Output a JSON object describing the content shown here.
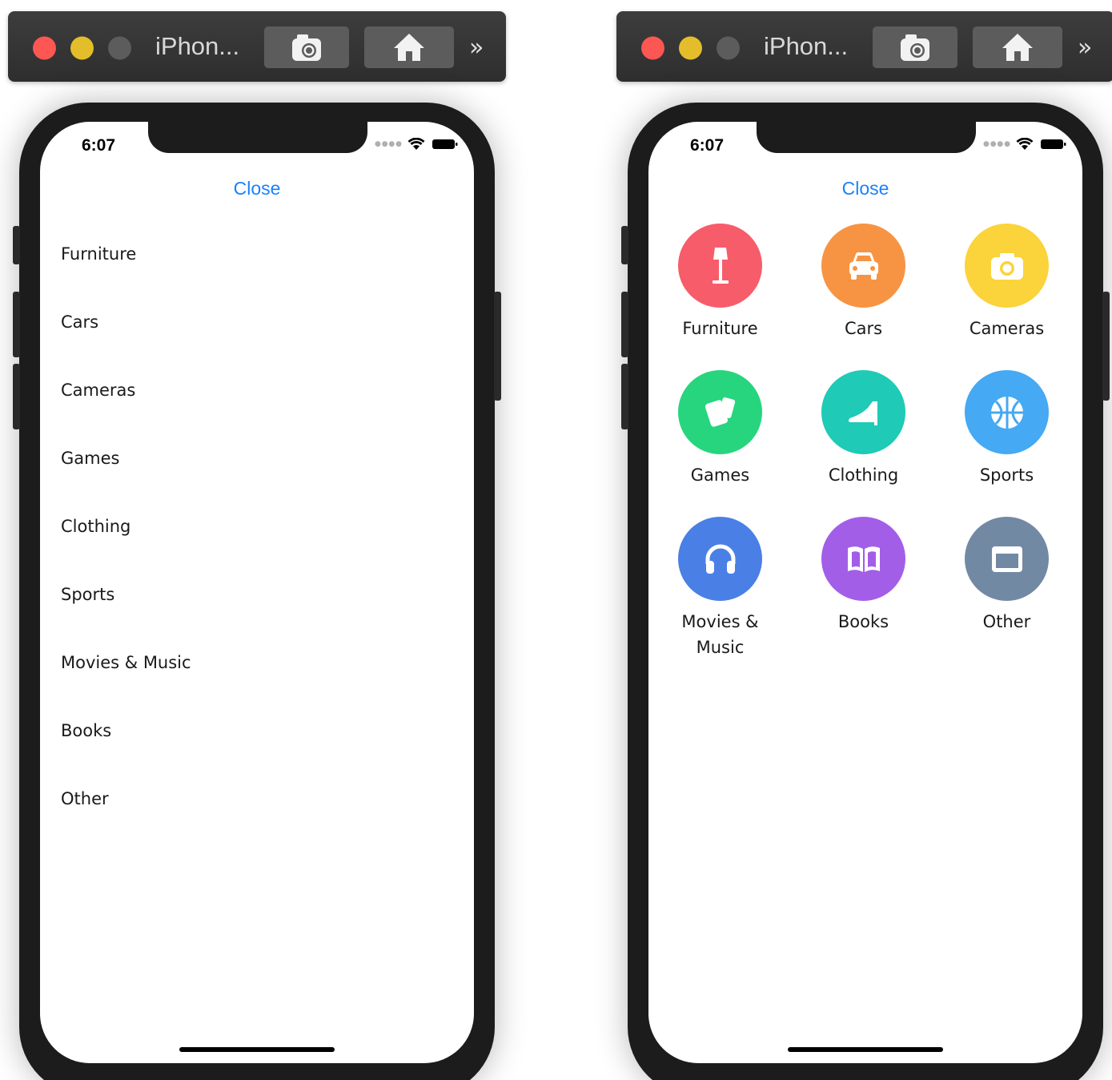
{
  "window": {
    "title": "iPhon...",
    "more_label": "»"
  },
  "status_bar": {
    "time": "6:07"
  },
  "close_label": "Close",
  "categories": [
    {
      "label": "Furniture",
      "icon": "lamp-icon",
      "color": "#f75c6a"
    },
    {
      "label": "Cars",
      "icon": "car-icon",
      "color": "#f79443"
    },
    {
      "label": "Cameras",
      "icon": "camera-icon",
      "color": "#fbd33a"
    },
    {
      "label": "Games",
      "icon": "cards-icon",
      "color": "#27d57e"
    },
    {
      "label": "Clothing",
      "icon": "shoe-icon",
      "color": "#1fcab6"
    },
    {
      "label": "Sports",
      "icon": "basketball-icon",
      "color": "#45a9f4"
    },
    {
      "label": "Movies & Music",
      "icon": "headphones-icon",
      "color": "#4a7fe6"
    },
    {
      "label": "Books",
      "icon": "book-icon",
      "color": "#a35ee8"
    },
    {
      "label": "Other",
      "icon": "window-icon",
      "color": "#7289a4"
    }
  ]
}
